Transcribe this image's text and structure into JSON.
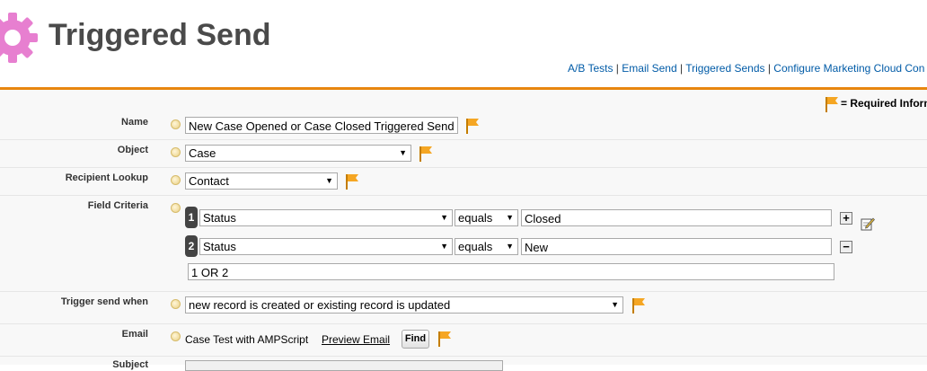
{
  "header": {
    "title": "Triggered Send",
    "links": [
      "A/B Tests",
      "Email Send",
      "Triggered Sends",
      "Configure Marketing Cloud Con"
    ],
    "separator": " | "
  },
  "required_legend": "= Required Inform",
  "form": {
    "name": {
      "label": "Name",
      "value": "New Case Opened or Case Closed Triggered Send"
    },
    "object": {
      "label": "Object",
      "value": "Case"
    },
    "recipient_lookup": {
      "label": "Recipient Lookup",
      "value": "Contact"
    },
    "field_criteria": {
      "label": "Field Criteria",
      "rows": [
        {
          "num": "1",
          "field": "Status",
          "operator": "equals",
          "value": "Closed"
        },
        {
          "num": "2",
          "field": "Status",
          "operator": "equals",
          "value": "New"
        }
      ],
      "logic": "1 OR 2"
    },
    "trigger": {
      "label": "Trigger send when",
      "value": "new record is created or existing record is updated"
    },
    "email": {
      "label": "Email",
      "value": "Case Test with AMPScript",
      "preview": "Preview Email",
      "find": "Find"
    },
    "subject": {
      "label": "Subject"
    }
  },
  "colors": {
    "accent": "#e8860e",
    "link": "#015ba7",
    "gear": "#e77fd0",
    "flag": "#f5a623"
  },
  "icons": {
    "gear": "gear-icon",
    "flag": "required-flag-icon",
    "help": "help-icon",
    "pencil": "edit-pencil-icon"
  }
}
